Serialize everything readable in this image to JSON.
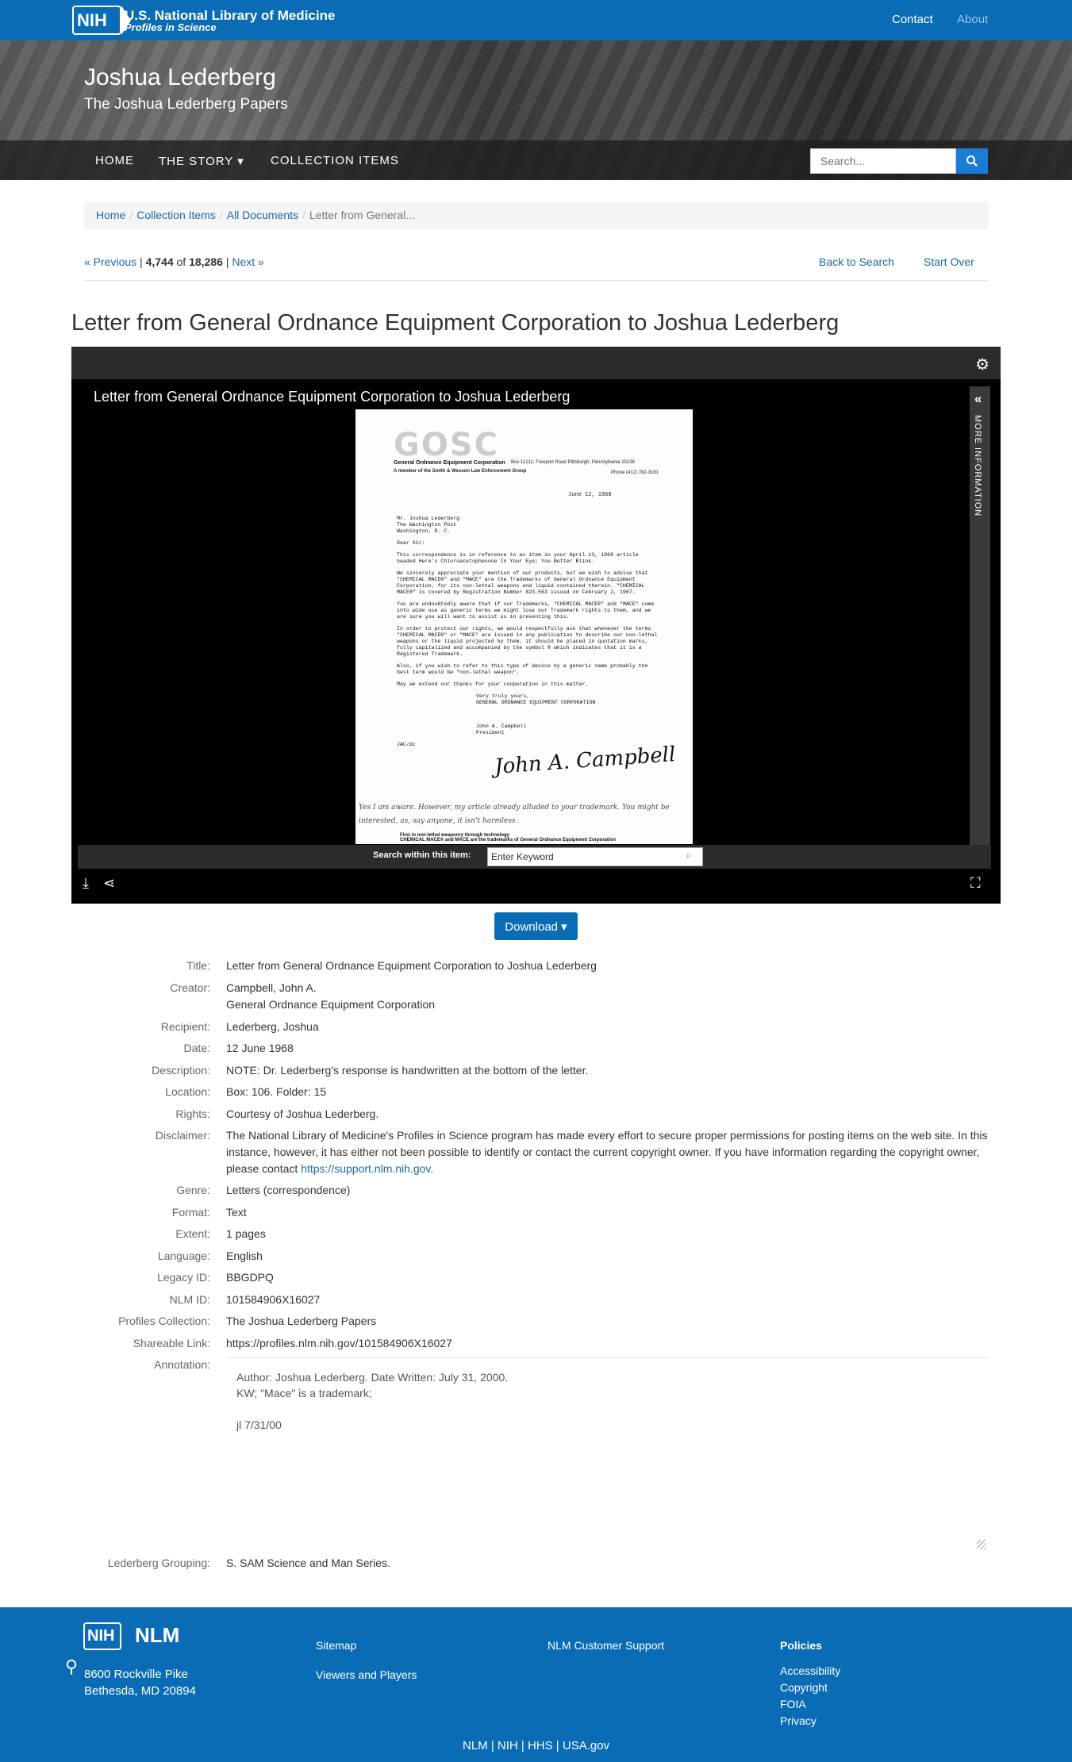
{
  "header": {
    "logo": "NIH",
    "org_title": "U.S. National Library of Medicine",
    "org_subtitle": "Profiles in Science",
    "contact": "Contact",
    "about": "About"
  },
  "hero": {
    "title": "Joshua Lederberg",
    "subtitle": "The Joshua Lederberg Papers",
    "nav": [
      "HOME",
      "THE STORY ▾",
      "COLLECTION ITEMS"
    ],
    "search_placeholder": "Search..."
  },
  "breadcrumb": [
    "Home",
    "Collection Items",
    "All Documents",
    "Letter from General..."
  ],
  "pager": {
    "previous": "« Previous",
    "current": "4,744",
    "of": "of",
    "total": "18,286",
    "next": "Next »",
    "back_to_search": "Back to Search",
    "start_over": "Start Over"
  },
  "page_title": "Letter from General Ordnance Equipment Corporation to Joshua Lederberg",
  "viewer": {
    "title": "Letter from General Ordnance Equipment Corporation to Joshua Lederberg",
    "more_information": "MORE INFORMATION",
    "search_label": "Search within this item:",
    "search_value": "Enter Keyword",
    "document": {
      "logo": "GOSC",
      "company": "General Ordnance Equipment Corporation",
      "address": "Box 11211, Freeport Road  Pittsburgh, Pennsylvania 15238",
      "member": "A member of the Smith & Wesson Law Enforcement Group",
      "phone": "Phone (412) 782-3181",
      "date": "June 12, 1968",
      "body": [
        "Mr. Joshua Lederberg\nThe Washington Post\nWashington, D. C.",
        "Dear Sir:",
        "This correspondence is in reference to an item in your April 13, 1968 article headed Here's Chloroacetophenone In Your Eye; You Better Blink.",
        "We sincerely appreciate your mention of our products, but we wish to advise that \"CHEMICAL MACE®\" and \"MACE\" are the Trademarks of General Ordnance Equipment Corporation, for its non-lethal weapons and liquid contained therein. \"CHEMICAL MACE®\" is covered by Registration Number 823,563 issued on February 2, 1967.",
        "You are undoubtedly aware that if our Trademarks, \"CHEMICAL MACE®\" and \"MACE\" come into wide use as generic terms we might lose our Trademark rights to them, and we are sure you will want to assist us in preventing this.",
        "In order to protect our rights, we would respectfully ask that whenever the terms \"CHEMICAL MACE®\" or \"MACE\" are issued in any publication to describe our non-lethal weapons or the liquid projected by them, it should be placed in quotation marks, fully capitalized and accompanied by the symbol ® which indicates that it is a Registered Trademark.",
        "Also, if you wish to refer to this type of device by a generic name probably the best term would be \"non-lethal weapon\".",
        "May we extend our thanks for your cooperation in this matter.",
        "Very truly yours,\nGENERAL ORDNANCE EQUIPMENT CORPORATION"
      ],
      "signature": "John A. Campbell",
      "signer": "John A. Campbell\nPresident",
      "initials": "JAC/dc",
      "handwritten": "Yes I am aware. However, my article already alluded to your trademark. You might be interested, as, say anyone, it isn't harmless.",
      "footer": "First in non-lethal weaponry through technology\nCHEMICAL MACE® and MACE are the trademarks of General Ordnance Equipment Corporation"
    }
  },
  "download_label": "Download ▾",
  "metadata": {
    "title_label": "Title:",
    "title": "Letter from General Ordnance Equipment Corporation to Joshua Lederberg",
    "creator_label": "Creator:",
    "creator_1": "Campbell, John A.",
    "creator_2": "General Ordnance Equipment Corporation",
    "recipient_label": "Recipient:",
    "recipient": "Lederberg, Joshua",
    "date_label": "Date:",
    "date": "12 June 1968",
    "description_label": "Description:",
    "description": "NOTE: Dr. Lederberg's response is handwritten at the bottom of the letter.",
    "location_label": "Location:",
    "location": "Box: 106. Folder: 15",
    "rights_label": "Rights:",
    "rights": "Courtesy of Joshua Lederberg.",
    "disclaimer_label": "Disclaimer:",
    "disclaimer": "The National Library of Medicine's Profiles in Science program has made every effort to secure proper permissions for posting items on the web site. In this instance, however, it has either not been possible to identify or contact the current copyright owner. If you have information regarding the copyright owner, please contact",
    "disclaimer_link": "https://support.nlm.nih.gov.",
    "genre_label": "Genre:",
    "genre": "Letters (correspondence)",
    "format_label": "Format:",
    "format": "Text",
    "extent_label": "Extent:",
    "extent": "1 pages",
    "language_label": "Language:",
    "language": "English",
    "legacy_label": "Legacy ID:",
    "legacy": "BBGDPQ",
    "nlm_label": "NLM ID:",
    "nlm": "101584906X16027",
    "collection_label": "Profiles Collection:",
    "collection": "The Joshua Lederberg Papers",
    "link_label": "Shareable Link:",
    "link": "https://profiles.nlm.nih.gov/101584906X16027",
    "annotation_label": "Annotation:",
    "annotation_1": "Author: Joshua Lederberg. Date Written: July 31, 2000.",
    "annotation_2": "KW;  \"Mace\" is a trademark;",
    "annotation_3": "jl  7/31/00",
    "grouping_label": "Lederberg Grouping:",
    "grouping": "S. SAM Science and Man Series."
  },
  "footer": {
    "logo": "NIH",
    "nlm": "NLM",
    "address_1": "8600 Rockville Pike",
    "address_2": "Bethesda, MD 20894",
    "sitemap": "Sitemap",
    "viewers": "Viewers and Players",
    "support": "NLM Customer Support",
    "policies": "Policies",
    "accessibility": "Accessibility",
    "copyright": "Copyright",
    "foia": "FOIA",
    "privacy": "Privacy",
    "bottom_links": "NLM | NIH | HHS | USA.gov"
  }
}
